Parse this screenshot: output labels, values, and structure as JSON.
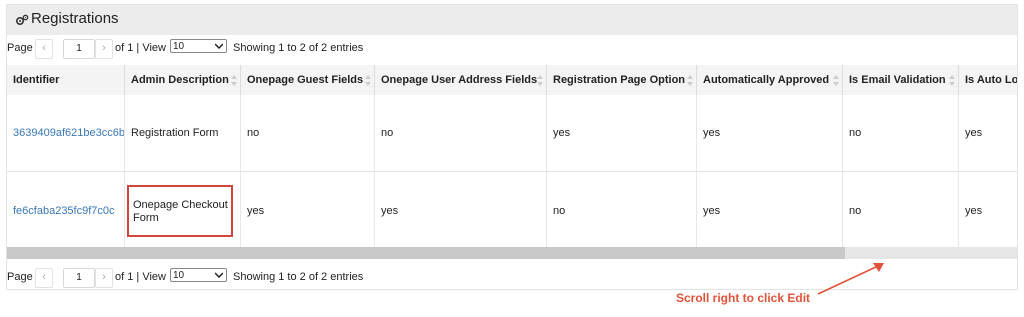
{
  "window": {
    "title": "Registrations",
    "title_icon": "gears-icon"
  },
  "pager": {
    "page_label": "Page",
    "prev_symbol": "‹",
    "next_symbol": "›",
    "current_page": "1",
    "of_text": "of 1 | View",
    "per_page": "10",
    "showing_text": "Showing 1 to 2 of 2 entries"
  },
  "table": {
    "columns": [
      "Identifier",
      "Admin Description",
      "Onepage Guest Fields",
      "Onepage User Address Fields",
      "Registration Page Option",
      "Automatically Approved",
      "Is Email Validation",
      "Is Auto Lo"
    ],
    "rows": [
      [
        "3639409af621be3cc6b",
        "Registration Form",
        "no",
        "no",
        "yes",
        "yes",
        "no",
        "yes"
      ],
      [
        "fe6cfaba235fc9f7c0c",
        "Onepage Checkout Form",
        "yes",
        "yes",
        "no",
        "yes",
        "no",
        "yes"
      ]
    ]
  },
  "annotation": {
    "text": "Scroll right to click Edit",
    "color": "#e0533a"
  },
  "colors": {
    "link": "#3a78b5",
    "highlight_border": "#d6453d",
    "header_bg": "#f4f4f4"
  }
}
